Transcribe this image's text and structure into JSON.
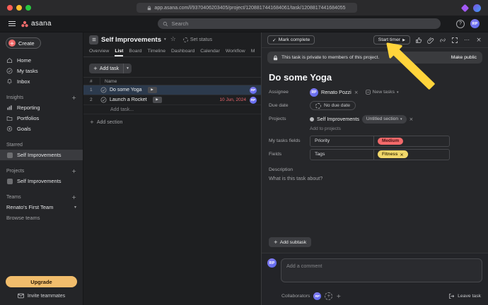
{
  "browser": {
    "url": "app.asana.com/l/9370406203405/project/1208817441684061/task/1208817441684055"
  },
  "topbar": {
    "logo": "asana",
    "search_placeholder": "Search",
    "help": "?",
    "avatar": "RP"
  },
  "sidebar": {
    "create": "Create",
    "nav": [
      {
        "label": "Home"
      },
      {
        "label": "My tasks"
      },
      {
        "label": "Inbox"
      }
    ],
    "insights": {
      "label": "Insights",
      "items": [
        {
          "label": "Reporting"
        },
        {
          "label": "Portfolios"
        },
        {
          "label": "Goals"
        }
      ]
    },
    "starred": {
      "label": "Starred",
      "items": [
        {
          "label": "Self Improvements"
        }
      ]
    },
    "projects": {
      "label": "Projects",
      "items": [
        {
          "label": "Self Improvements"
        }
      ]
    },
    "teams": {
      "label": "Teams",
      "items": [
        {
          "label": "Renato's First Team"
        },
        {
          "label": "Browse teams"
        }
      ]
    },
    "upgrade": "Upgrade",
    "invite": "Invite teammates"
  },
  "project": {
    "title": "Self Improvements",
    "set_status": "Set status",
    "tabs": [
      {
        "label": "Overview"
      },
      {
        "label": "List"
      },
      {
        "label": "Board"
      },
      {
        "label": "Timeline"
      },
      {
        "label": "Dashboard"
      },
      {
        "label": "Calendar"
      },
      {
        "label": "Workflow"
      },
      {
        "label": "M"
      }
    ],
    "add_task": "Add task",
    "columns": {
      "num": "#",
      "name": "Name"
    },
    "rows": [
      {
        "num": "1",
        "name": "Do some Yoga",
        "due": "",
        "assignee": "RP"
      },
      {
        "num": "2",
        "name": "Launch a Rocket",
        "due": "10 Jun, 2024",
        "assignee": "RP"
      }
    ],
    "add_task_row": "Add task...",
    "add_section": "Add section"
  },
  "task": {
    "mark_complete": "Mark complete",
    "start_timer": "Start timer",
    "banner_text": "This task is private to members of this project.",
    "banner_action": "Make public",
    "title": "Do some Yoga",
    "assignee_label": "Assignee",
    "assignee_avatar": "RP",
    "assignee_name": "Renato Pozzi",
    "assignee_extra": "New tasks",
    "due_label": "Due date",
    "due_value": "No due date",
    "projects_label": "Projects",
    "project_name": "Self Improvements",
    "project_section": "Untitled section",
    "add_to_projects": "Add to projects",
    "my_tasks_fields_label": "My tasks fields",
    "priority_label": "Priority",
    "priority_value": "Medium",
    "fields_label": "Fields",
    "tags_label": "Tags",
    "tags_value": "Fitness",
    "description_label": "Description",
    "description_placeholder": "What is this task about?",
    "add_subtask": "Add subtask",
    "comment_avatar": "RP",
    "comment_placeholder": "Add a comment",
    "collaborators_label": "Collaborators",
    "collab_avatar": "RP",
    "leave_task": "Leave task"
  },
  "icons": {
    "plus": "+",
    "caret-down": "▾",
    "chevron-right": "›",
    "star": "☆",
    "play": "▶",
    "check": "✓",
    "more": "⋯",
    "close": "×",
    "multiply": "×"
  },
  "colors": {
    "brand_coral": "#f06a6a",
    "priority_medium_bg": "#f2696a",
    "tag_fitness_bg": "#f1d76a",
    "due_date_red": "#e8646c",
    "upgrade_amber": "#f1bd6c",
    "selected_row_bg": "#2c3a4d",
    "annotation_arrow": "#ffd43b"
  }
}
